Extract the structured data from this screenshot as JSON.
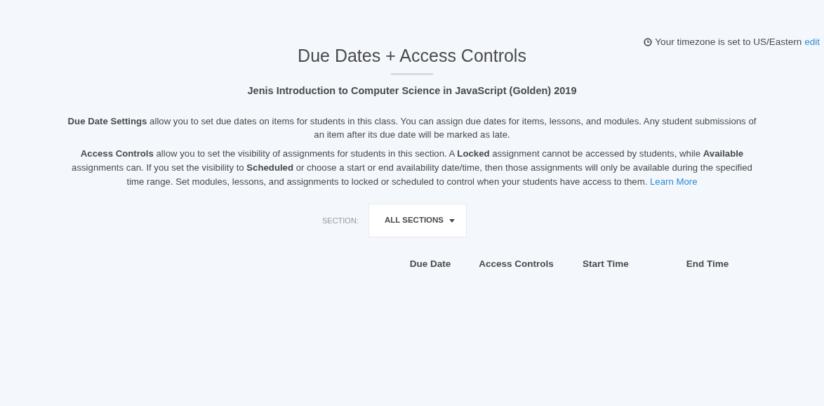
{
  "timezone": {
    "text": "Your timezone is set to US/Eastern",
    "link": "edit"
  },
  "title": "Due Dates + Access Controls",
  "course": "Jenis Introduction to Computer Science in JavaScript (Golden) 2019",
  "paragraphs": [
    {
      "text": "**Due Date Settings** allow you to set due dates on items for students in this class. You can assign due dates for items, lessons, and modules. Any student submissions of an item after its due date will be marked as late."
    },
    {
      "text": "**Access Controls** allow you to set the visibility of assignments for students in this section. A **Locked** assignment cannot be accessed by students, while **Available** assignments can. If you set the visibility to **Scheduled** or choose a start or end availability date/time, then those assignments will only be available during the specified time range. Set modules, lessons, and assignments to locked or scheduled to control when your students have access to them.",
      "link": "Learn More"
    }
  ],
  "section": {
    "label": "SECTION:",
    "value": "ALL SECTIONS"
  },
  "table": {
    "columns": [
      "Due Date",
      "Access Controls",
      "Start Time",
      "End Time"
    ]
  }
}
